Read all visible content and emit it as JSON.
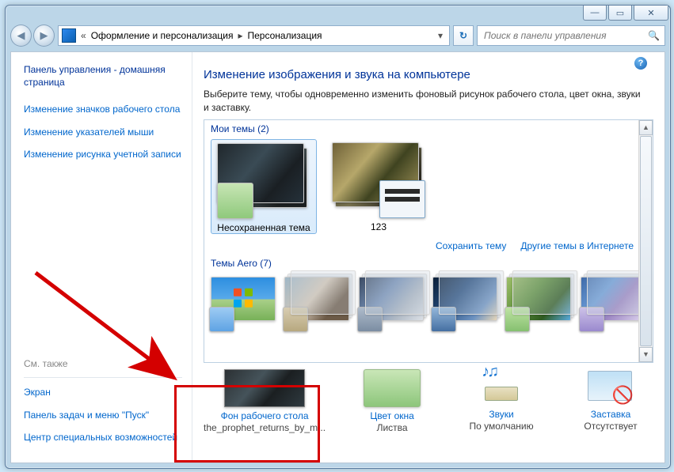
{
  "titlebar": {
    "minimize": "—",
    "maximize": "▭",
    "close": "✕"
  },
  "nav": {
    "back": "◀",
    "forward": "▶",
    "crumbs_prefix": "«",
    "crumb1": "Оформление и персонализация",
    "crumb2": "Персонализация",
    "arrow": "▸",
    "dropdown": "▾",
    "refresh": "↻"
  },
  "search": {
    "placeholder": "Поиск в панели управления",
    "icon": "🔍"
  },
  "help": "?",
  "sidebar": {
    "home": "Панель управления - домашняя страница",
    "links": [
      "Изменение значков рабочего стола",
      "Изменение указателей мыши",
      "Изменение рисунка учетной записи"
    ],
    "see_also_title": "См. также",
    "see_also": [
      "Экран",
      "Панель задач и меню \"Пуск\"",
      "Центр специальных возможностей"
    ]
  },
  "main": {
    "title": "Изменение изображения и звука на компьютере",
    "instruction": "Выберите тему, чтобы одновременно изменить фоновый рисунок рабочего стола, цвет окна, звуки и заставку.",
    "my_themes": {
      "title": "Мои темы (2)",
      "count": 2
    },
    "themes": [
      {
        "label": "Несохраненная тема"
      },
      {
        "label": "123"
      }
    ],
    "save_theme": "Сохранить тему",
    "more_themes": "Другие темы в Интернете",
    "aero": {
      "title": "Темы Aero (7)",
      "count": 7
    },
    "scroll": {
      "up": "▲",
      "down": "▼"
    }
  },
  "bottom": [
    {
      "link": "Фон рабочего стола",
      "sub": "the_prophet_returns_by_m..."
    },
    {
      "link": "Цвет окна",
      "sub": "Листва"
    },
    {
      "link": "Звуки",
      "sub": "По умолчанию"
    },
    {
      "link": "Заставка",
      "sub": "Отсутствует"
    }
  ]
}
